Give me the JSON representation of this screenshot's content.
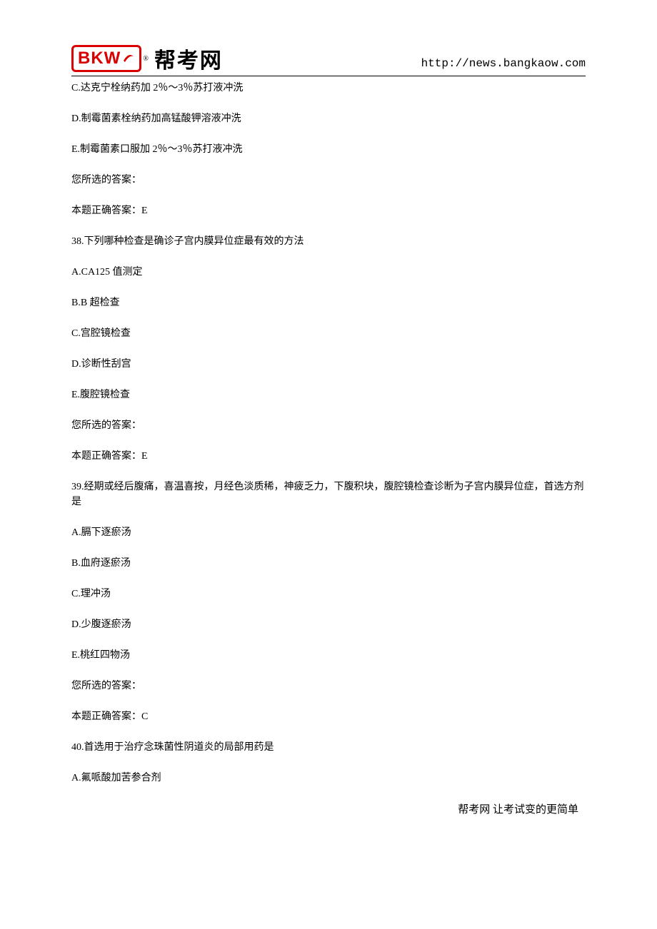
{
  "header": {
    "logo_bkw": "BKW",
    "logo_text": "帮考网",
    "reg_mark": "®",
    "site_url": "http://news.bangkaow.com"
  },
  "lines": [
    "C.达克宁栓纳药加 2％～3％苏打液冲洗",
    "D.制霉菌素栓纳药加高锰酸钾溶液冲洗",
    "E.制霉菌素口服加 2％～3％苏打液冲洗",
    "您所选的答案：",
    "本题正确答案：E",
    "38.下列哪种检查是确诊子宫内膜异位症最有效的方法",
    "A.CA125 值测定",
    "B.B 超检查",
    "C.宫腔镜检查",
    "D.诊断性刮宫",
    "E.腹腔镜检查",
    "您所选的答案：",
    "本题正确答案：E",
    "39.经期或经后腹痛，喜温喜按，月经色淡质稀，神疲乏力，下腹积块，腹腔镜检查诊断为子宫内膜异位症，首选方剂是",
    "A.膈下逐瘀汤",
    "B.血府逐瘀汤",
    "C.理冲汤",
    "D.少腹逐瘀汤",
    "E.桃红四物汤",
    "您所选的答案：",
    "本题正确答案：C",
    "40.首选用于治疗念珠菌性阴道炎的局部用药是",
    "A.氟哌酸加苦参合剂"
  ],
  "footer": "帮考网 让考试变的更简单"
}
